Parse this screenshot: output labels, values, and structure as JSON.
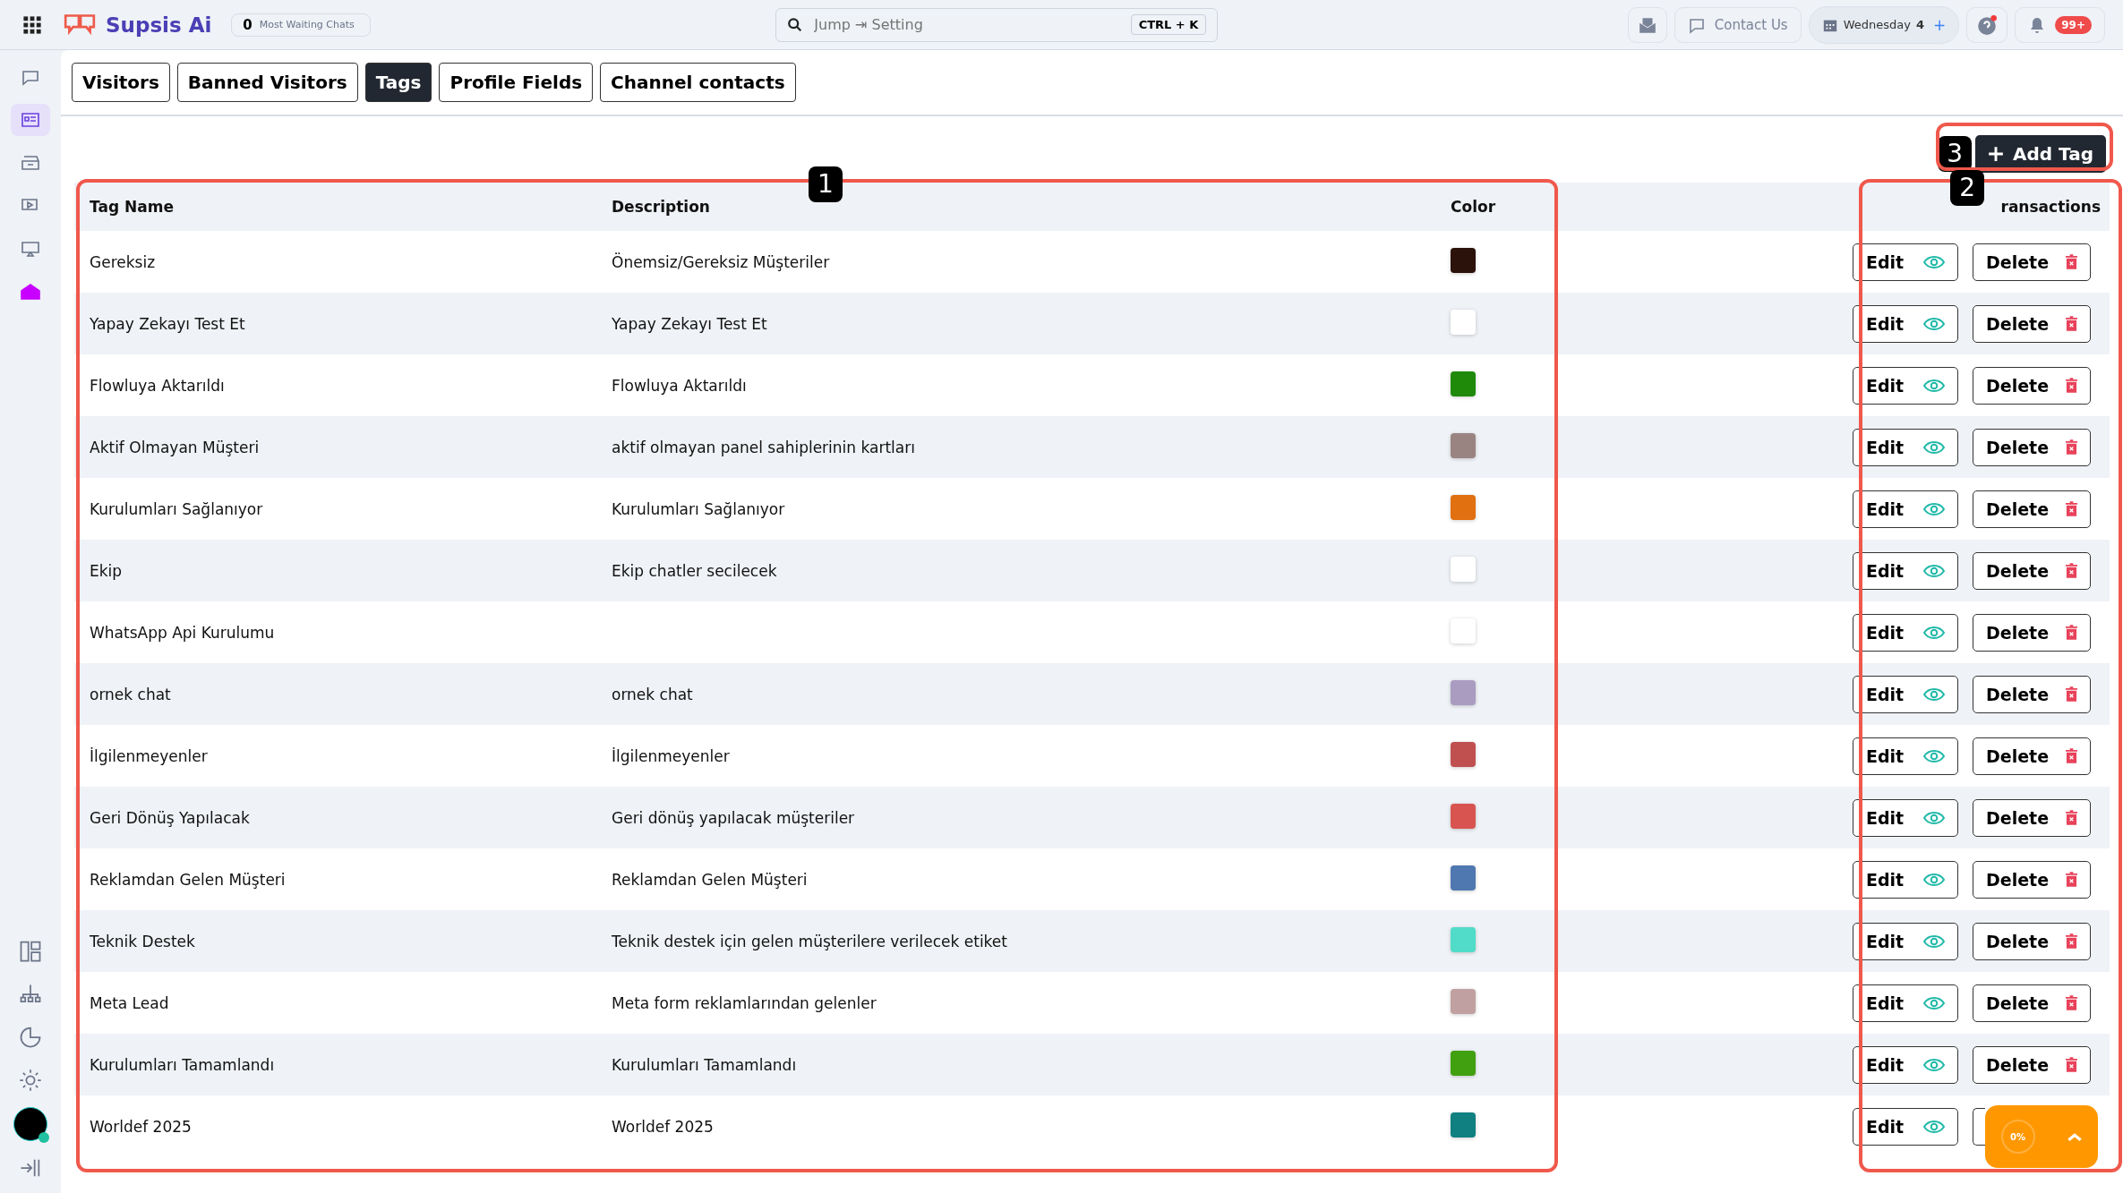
{
  "brand": "Supsis Ai",
  "waiting": {
    "count": "0",
    "label": "Most Waiting Chats"
  },
  "search": {
    "placeholder": "Jump ⇥ Setting",
    "shortcut": "CTRL + K"
  },
  "contact": "Contact Us",
  "date": {
    "day": "Wednesday",
    "number": "4",
    "add": "+"
  },
  "notifications": "99+",
  "sidebar": [
    {
      "selected": false
    },
    {
      "selected": true
    },
    {
      "selected": false
    },
    {
      "selected": false
    },
    {
      "selected": false
    },
    {
      "selected": false
    }
  ],
  "tabs": [
    {
      "label": "Visitors",
      "selected": false
    },
    {
      "label": "Banned Visitors",
      "selected": false
    },
    {
      "label": "Tags",
      "selected": true
    },
    {
      "label": "Profile Fields",
      "selected": false
    },
    {
      "label": "Channel contacts",
      "selected": false
    }
  ],
  "add_button": "Add Tag",
  "annotations": [
    "1",
    "2",
    "3"
  ],
  "table": {
    "columns": [
      "Tag Name",
      "Description",
      "Color",
      "ransactions"
    ],
    "rows": [
      {
        "name": "Gereksiz",
        "description": "Önemsiz/Gereksiz Müşteriler",
        "color": "#2b120a",
        "edit": "Edit",
        "delete": "Delete"
      },
      {
        "name": "Yapay Zekayı Test Et",
        "description": "Yapay Zekayı Test Et",
        "color": "#ffffff",
        "edit": "Edit",
        "delete": "Delete"
      },
      {
        "name": "Flowluya Aktarıldı",
        "description": "Flowluya Aktarıldı",
        "color": "#1f8a0a",
        "edit": "Edit",
        "delete": "Delete"
      },
      {
        "name": "Aktif Olmayan Müşteri",
        "description": "aktif olmayan panel sahiplerinin kartları",
        "color": "#9a8482",
        "edit": "Edit",
        "delete": "Delete"
      },
      {
        "name": "Kurulumları Sağlanıyor",
        "description": "Kurulumları Sağlanıyor",
        "color": "#e07010",
        "edit": "Edit",
        "delete": "Delete"
      },
      {
        "name": "Ekip",
        "description": "Ekip chatler secilecek",
        "color": "#ffffff",
        "edit": "Edit",
        "delete": "Delete"
      },
      {
        "name": "WhatsApp Api Kurulumu",
        "color": "#ffffff",
        "edit": "Edit",
        "delete": "Delete"
      },
      {
        "name": "ornek chat",
        "description": "ornek chat",
        "color": "#a99cc0",
        "edit": "Edit",
        "delete": "Delete"
      },
      {
        "name": "İlgilenmeyenler",
        "description": "İlgilenmeyenler",
        "color": "#c05050",
        "edit": "Edit",
        "delete": "Delete"
      },
      {
        "name": "Geri Dönüş Yapılacak",
        "description": "Geri dönüş yapılacak müşteriler",
        "color": "#d85450",
        "edit": "Edit",
        "delete": "Delete"
      },
      {
        "name": "Reklamdan Gelen Müşteri",
        "description": "Reklamdan Gelen Müşteri",
        "color": "#5078b0",
        "edit": "Edit",
        "delete": "Delete"
      },
      {
        "name": "Teknik Destek",
        "description": "Teknik destek için gelen müşterilere verilecek etiket",
        "color": "#50dcc8",
        "edit": "Edit",
        "delete": "Delete"
      },
      {
        "name": "Meta Lead",
        "description": "Meta form reklamlarından gelenler",
        "color": "#c0a0a0",
        "edit": "Edit",
        "delete": "Delete"
      },
      {
        "name": "Kurulumları Tamamlandı",
        "description": "Kurulumları Tamamlandı",
        "color": "#40a010",
        "edit": "Edit",
        "delete": "Delete"
      },
      {
        "name": "Worldef 2025",
        "description": "Worldef 2025",
        "color": "#108080",
        "edit": "Edit"
      }
    ]
  },
  "scroll_widget": {
    "progress": "0%"
  }
}
